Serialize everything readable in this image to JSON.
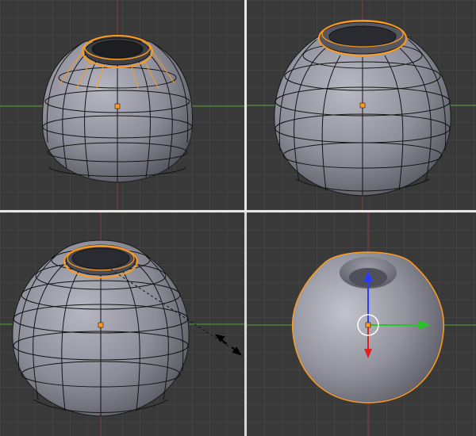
{
  "viewports": [
    {
      "id": "top-left",
      "selection": "top-edge-loop",
      "tool": "select"
    },
    {
      "id": "top-right",
      "selection": "inner-edge-loop",
      "tool": "select"
    },
    {
      "id": "bottom-left",
      "selection": "inner-edge-loop",
      "tool": "scale"
    },
    {
      "id": "bottom-right",
      "selection": "object",
      "tool": "translate-manipulator"
    }
  ],
  "colors": {
    "background": "#393939",
    "grid": "#434343",
    "x_axis": "#5aa038",
    "y_axis": "#8a3a3a",
    "mesh_fill": "#8e8f9a",
    "wire": "#141414",
    "selection": "#ff9a1a",
    "origin": "#ff9a1a",
    "arrow_z": "#2a3cff",
    "arrow_x": "#27c427",
    "arrow_y": "#e02020"
  },
  "icons": [
    "object-origin-icon",
    "scale-cursor-icon",
    "translate-manipulator-icon"
  ]
}
